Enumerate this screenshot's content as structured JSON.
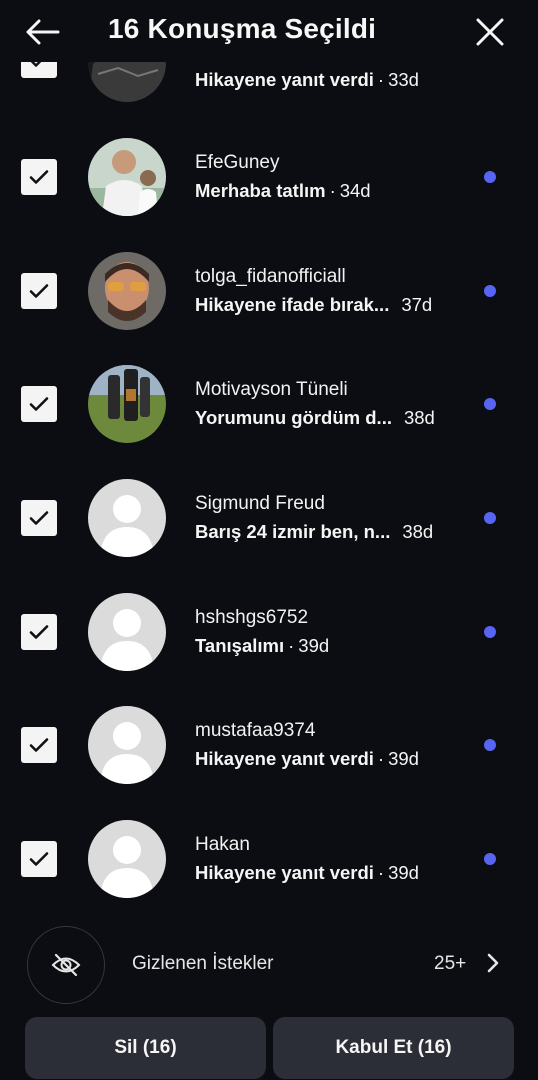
{
  "header": {
    "title": "16 Konuşma Seçildi",
    "back_icon": "arrow-left-icon",
    "close_icon": "close-icon"
  },
  "conversations": [
    {
      "name": "",
      "preview": "Hikayene yanıt verdi",
      "time": "33d",
      "checked": true,
      "avatar": "photo"
    },
    {
      "name": "EfeGuney",
      "preview": "Merhaba tatlım",
      "time": "34d",
      "checked": true,
      "avatar": "photo"
    },
    {
      "name": "tolga_fidanofficiall",
      "preview": "Hikayene ifade bırak...",
      "time": "37d",
      "checked": true,
      "avatar": "photo"
    },
    {
      "name": "Motivayson Tüneli",
      "preview": "Yorumunu gördüm d...",
      "time": "38d",
      "checked": true,
      "avatar": "photo"
    },
    {
      "name": "Sigmund Freud",
      "preview": "Barış 24 izmir ben, n...",
      "time": "38d",
      "checked": true,
      "avatar": "default"
    },
    {
      "name": "hshshgs6752",
      "preview": "Tanışalımı",
      "time": "39d",
      "checked": true,
      "avatar": "default"
    },
    {
      "name": "mustafaa9374",
      "preview": "Hikayene yanıt verdi",
      "time": "39d",
      "checked": true,
      "avatar": "default"
    },
    {
      "name": "Hakan",
      "preview": "Hikayene yanıt verdi",
      "time": "39d",
      "checked": true,
      "avatar": "default"
    }
  ],
  "hidden_requests": {
    "label": "Gizlenen İstekler",
    "count": "25+",
    "icon": "eye-off-icon"
  },
  "footer": {
    "delete_label": "Sil (16)",
    "accept_label": "Kabul Et (16)"
  },
  "colors": {
    "background": "#0b0d12",
    "unread_dot": "#5865f2",
    "button_bg": "#2b2e36"
  }
}
